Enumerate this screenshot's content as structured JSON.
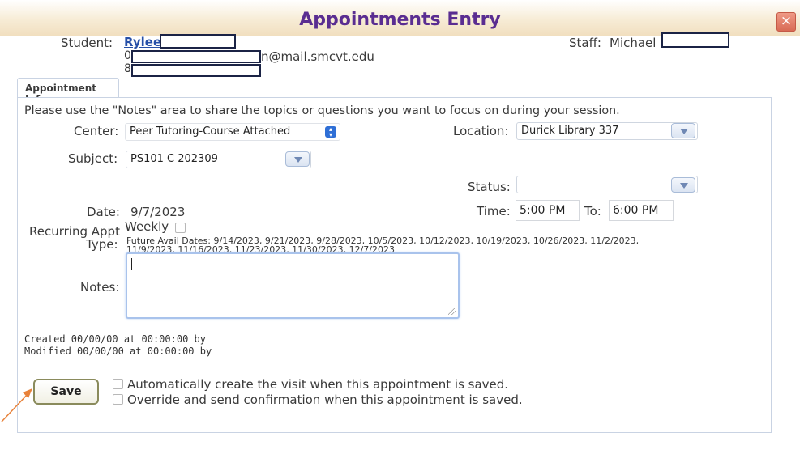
{
  "window": {
    "title": "Appointments Entry",
    "close_label": "×"
  },
  "student": {
    "label": "Student:",
    "name": "Rylee",
    "id_prefix": "0",
    "email_suffix": "n@mail.smcvt.edu",
    "phone_prefix": "8"
  },
  "staff": {
    "label": "Staff:",
    "name": "Michael"
  },
  "tab": {
    "label": "Appointment Info"
  },
  "instructions": "Please use the \"Notes\" area to share the topics or questions you want to focus on during your session.",
  "center": {
    "label": "Center:",
    "value": "Peer Tutoring-Course Attached"
  },
  "location": {
    "label": "Location:",
    "value": "Durick Library 337"
  },
  "subject": {
    "label": "Subject:",
    "value": "PS101 C 202309"
  },
  "status": {
    "label": "Status:",
    "value": ""
  },
  "date": {
    "label": "Date:",
    "value": "9/7/2023"
  },
  "time": {
    "label": "Time:",
    "from": "5:00 PM",
    "to_label": "To:",
    "to": "6:00 PM"
  },
  "recurring": {
    "label_line1": "Recurring Appt",
    "label_line2": "Type:",
    "option": "Weekly",
    "future_dates_line1": "Future Avail Dates: 9/14/2023, 9/21/2023, 9/28/2023, 10/5/2023, 10/12/2023, 10/19/2023, 10/26/2023, 11/2/2023,",
    "future_dates_line2": "11/9/2023, 11/16/2023, 11/23/2023, 11/30/2023, 12/7/2023"
  },
  "notes": {
    "label": "Notes:",
    "value": ""
  },
  "audit": {
    "created": "Created 00/00/00 at 00:00:00 by",
    "modified": "Modified 00/00/00 at 00:00:00 by"
  },
  "actions": {
    "save_label": "Save",
    "auto_create_label": "Automatically create the visit when this appointment is saved.",
    "override_label": "Override and send confirmation when this appointment is saved."
  },
  "colors": {
    "title": "#5a2d91",
    "link": "#2750a8",
    "close": "#d96a55",
    "arrow": "#e8823a"
  }
}
